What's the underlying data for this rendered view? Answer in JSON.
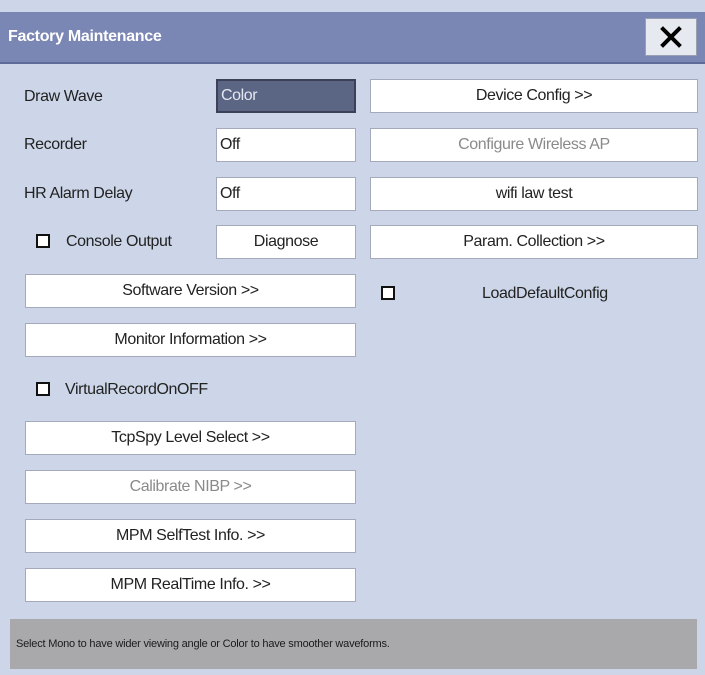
{
  "window": {
    "title": "Factory Maintenance"
  },
  "settings": {
    "draw_wave": {
      "label": "Draw Wave",
      "value": "Color"
    },
    "recorder": {
      "label": "Recorder",
      "value": "Off"
    },
    "hr_alarm_delay": {
      "label": "HR Alarm Delay",
      "value": "Off"
    },
    "console_output": {
      "label": "Console Output",
      "checked": false
    }
  },
  "buttons": {
    "diagnose": "Diagnose",
    "software_version": "Software Version >>",
    "monitor_information": "Monitor Information >>",
    "tcpspy_level_select": "TcpSpy Level Select >>",
    "calibrate_nibp": "Calibrate NIBP >>",
    "mpm_selftest_info": "MPM SelfTest Info. >>",
    "mpm_realtime_info": "MPM RealTime Info. >>",
    "device_config": "Device Config >>",
    "configure_wireless_ap": "Configure Wireless AP",
    "wifi_law_test": "wifi law test",
    "param_collection": "Param. Collection >>"
  },
  "checkboxes": {
    "virtual_record": {
      "label": "VirtualRecordOnOFF",
      "checked": false
    },
    "load_default_config": {
      "label": "LoadDefaultConfig",
      "checked": false
    }
  },
  "status": {
    "help_text": "Select Mono to have wider viewing angle or Color to have smoother waveforms."
  },
  "colors": {
    "title_bar": "#7a86b4",
    "background": "#ccd6e8",
    "selected_field": "#5b6584",
    "status_bar": "#a9a9ab"
  },
  "icons": {
    "close": "close-icon"
  }
}
